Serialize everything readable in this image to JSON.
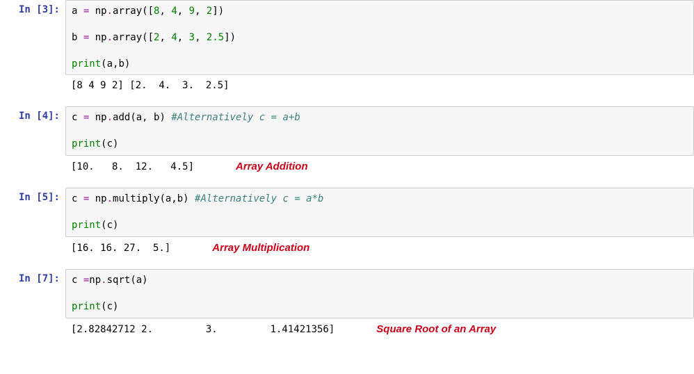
{
  "cells": [
    {
      "prompt": "In [3]:",
      "output": "[8 4 9 2] [2.  4.  3.  2.5]",
      "annotation": ""
    },
    {
      "prompt": "In [4]:",
      "output": "[10.   8.  12.   4.5]",
      "annotation": "Array Addition"
    },
    {
      "prompt": "In [5]:",
      "output": "[16. 16. 27.  5.]",
      "annotation": "Array Multiplication"
    },
    {
      "prompt": "In [7]:",
      "output": "[2.82842712 2.         3.         1.41421356]",
      "annotation": "Square Root of an Array"
    }
  ],
  "code": {
    "c0l0_a": "a ",
    "c0l0_eq": "= ",
    "c0l0_np": "np",
    "c0l0_dot": ".",
    "c0l0_fn": "array",
    "c0l0_open": "([",
    "c0l0_n1": "8",
    "c0l0_c1": ", ",
    "c0l0_n2": "4",
    "c0l0_c2": ", ",
    "c0l0_n3": "9",
    "c0l0_c3": ", ",
    "c0l0_n4": "2",
    "c0l0_close": "])",
    "c0l1_b": "b ",
    "c0l1_eq": "= ",
    "c0l1_np": "np",
    "c0l1_dot": ".",
    "c0l1_fn": "array",
    "c0l1_open": "([",
    "c0l1_n1": "2",
    "c0l1_c1": ", ",
    "c0l1_n2": "4",
    "c0l1_c2": ", ",
    "c0l1_n3": "3",
    "c0l1_c3": ", ",
    "c0l1_n4": "2.5",
    "c0l1_close": "])",
    "c0l2_print": "print",
    "c0l2_args": "(a,b)",
    "c1l0_c": "c ",
    "c1l0_eq": "= ",
    "c1l0_np": "np",
    "c1l0_dot": ".",
    "c1l0_fn": "add",
    "c1l0_args": "(a, b) ",
    "c1l0_comment": "#Alternatively c = a+b",
    "c1l1_print": "print",
    "c1l1_args": "(c)",
    "c2l0_c": "c ",
    "c2l0_eq": "= ",
    "c2l0_np": "np",
    "c2l0_dot": ".",
    "c2l0_fn": "multiply",
    "c2l0_args": "(a,b) ",
    "c2l0_comment": "#Alternatively c = a*b",
    "c2l1_print": "print",
    "c2l1_args": "(c)",
    "c3l0_c": "c ",
    "c3l0_eq": "=",
    "c3l0_np": "np",
    "c3l0_dot": ".",
    "c3l0_fn": "sqrt",
    "c3l0_args": "(a)",
    "c3l1_print": "print",
    "c3l1_args": "(c)"
  }
}
